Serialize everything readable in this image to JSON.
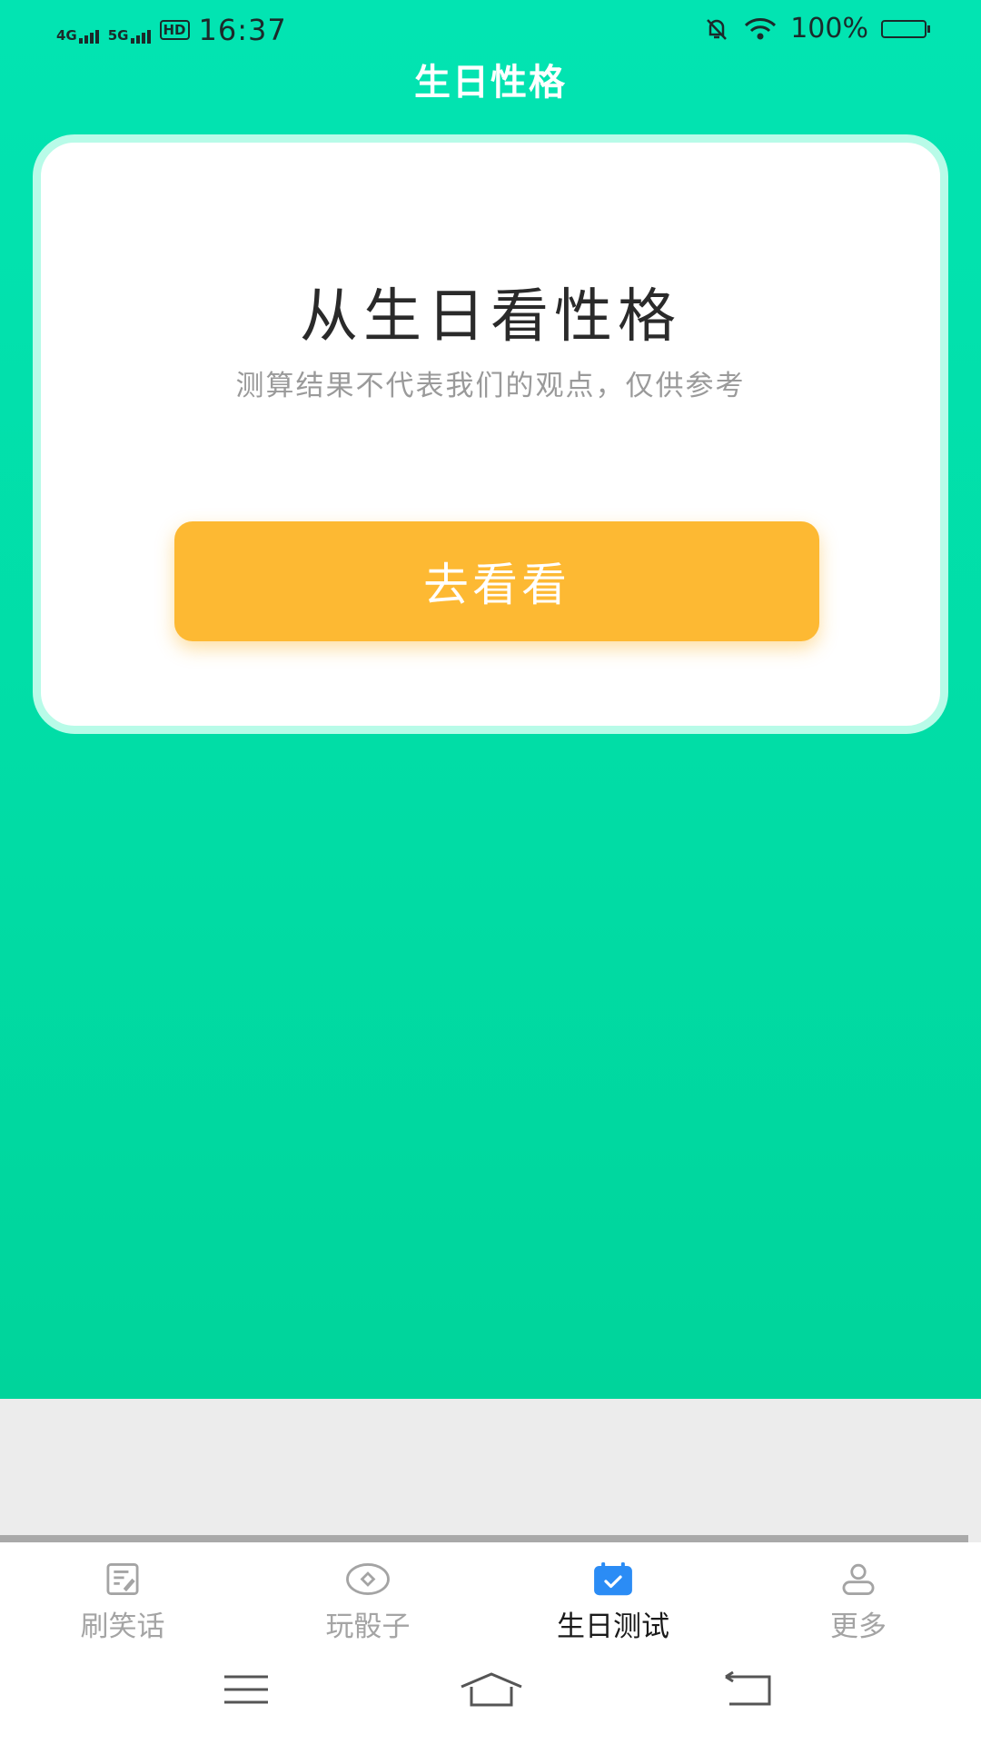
{
  "status_bar": {
    "signal_1": "4G",
    "signal_2": "5G",
    "hd": "HD",
    "time": "16:37",
    "battery": "100%"
  },
  "header": {
    "title": "生日性格"
  },
  "card": {
    "title": "从生日看性格",
    "subtitle": "测算结果不代表我们的观点，仅供参考",
    "button_label": "去看看"
  },
  "tabs": [
    {
      "label": "刷笑话",
      "icon": "edit-note-icon",
      "active": false
    },
    {
      "label": "玩骰子",
      "icon": "dice-icon",
      "active": false
    },
    {
      "label": "生日测试",
      "icon": "calendar-check-icon",
      "active": true
    },
    {
      "label": "更多",
      "icon": "user-icon",
      "active": false
    }
  ],
  "nav": [
    "menu-icon",
    "home-icon",
    "back-icon"
  ],
  "colors": {
    "primary_green": "#02e4b2",
    "button_orange": "#fdb933",
    "active_tab_blue": "#2b8cf5"
  }
}
